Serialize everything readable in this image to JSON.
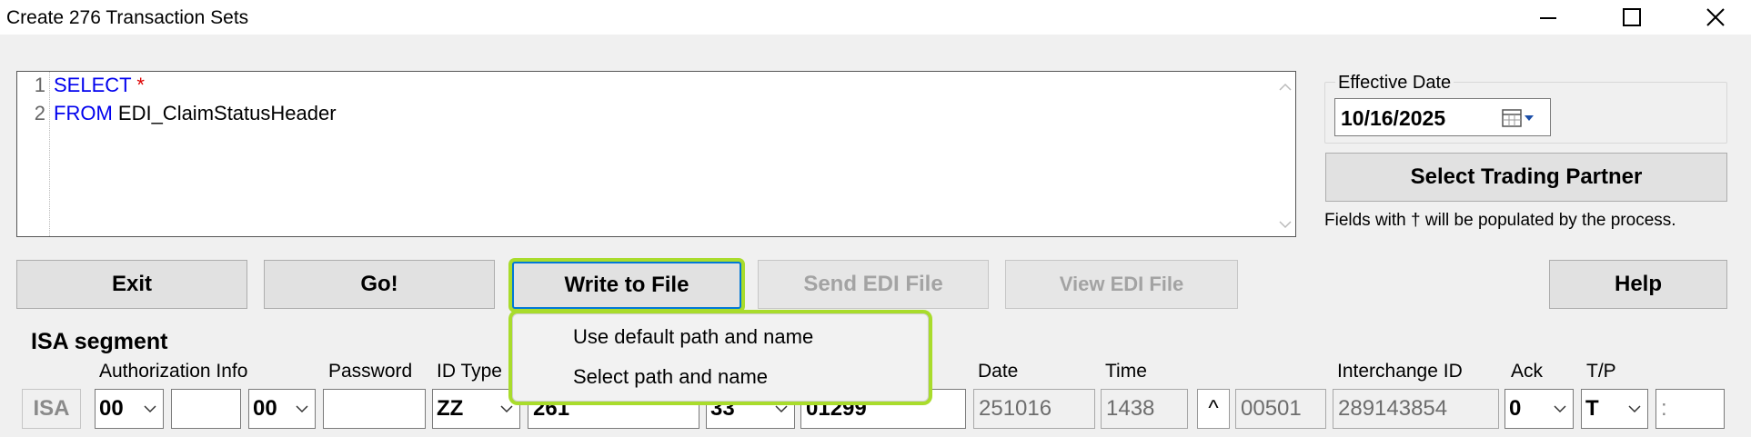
{
  "window": {
    "title": "Create 276 Transaction Sets"
  },
  "editor": {
    "lines": [
      {
        "no": "1",
        "keyword": "SELECT",
        "rest": "*"
      },
      {
        "no": "2",
        "keyword": "FROM",
        "rest": "EDI_ClaimStatusHeader"
      }
    ]
  },
  "effective_date": {
    "label": "Effective Date",
    "value": "10/16/2025"
  },
  "buttons": {
    "select_trading_partner": "Select Trading Partner",
    "exit": "Exit",
    "go": "Go!",
    "write_to_file": "Write to File",
    "send_edi_file": "Send EDI File",
    "view_edi_file": "View EDI File",
    "help": "Help"
  },
  "note": "Fields with † will be populated by the process.",
  "menu": {
    "items": [
      "Use default path and name",
      "Select path and name"
    ]
  },
  "isa": {
    "title": "ISA segment",
    "prefix": "ISA",
    "labels": {
      "authorization": "Authorization Info",
      "password": "Password",
      "id_type": "ID Type",
      "date": "Date",
      "time": "Time",
      "interchange_id": "Interchange ID",
      "ack": "Ack",
      "tp": "T/P"
    },
    "auth_qualifier": "00",
    "auth_info": "",
    "password_qualifier": "00",
    "password": "",
    "sender_id_type": "ZZ",
    "sender_id": "261",
    "receiver_id_type": "33",
    "receiver_id": "01299",
    "date": "251016",
    "time": "1438",
    "caret": "^",
    "version": "00501",
    "interchange_id": "289143854",
    "ack": "0",
    "tp": "T",
    "separator": ":"
  },
  "colors": {
    "focus": "#0078d7",
    "highlight": "#a9dc2c",
    "keyword": "#0000ee",
    "star": "#dd0000"
  }
}
